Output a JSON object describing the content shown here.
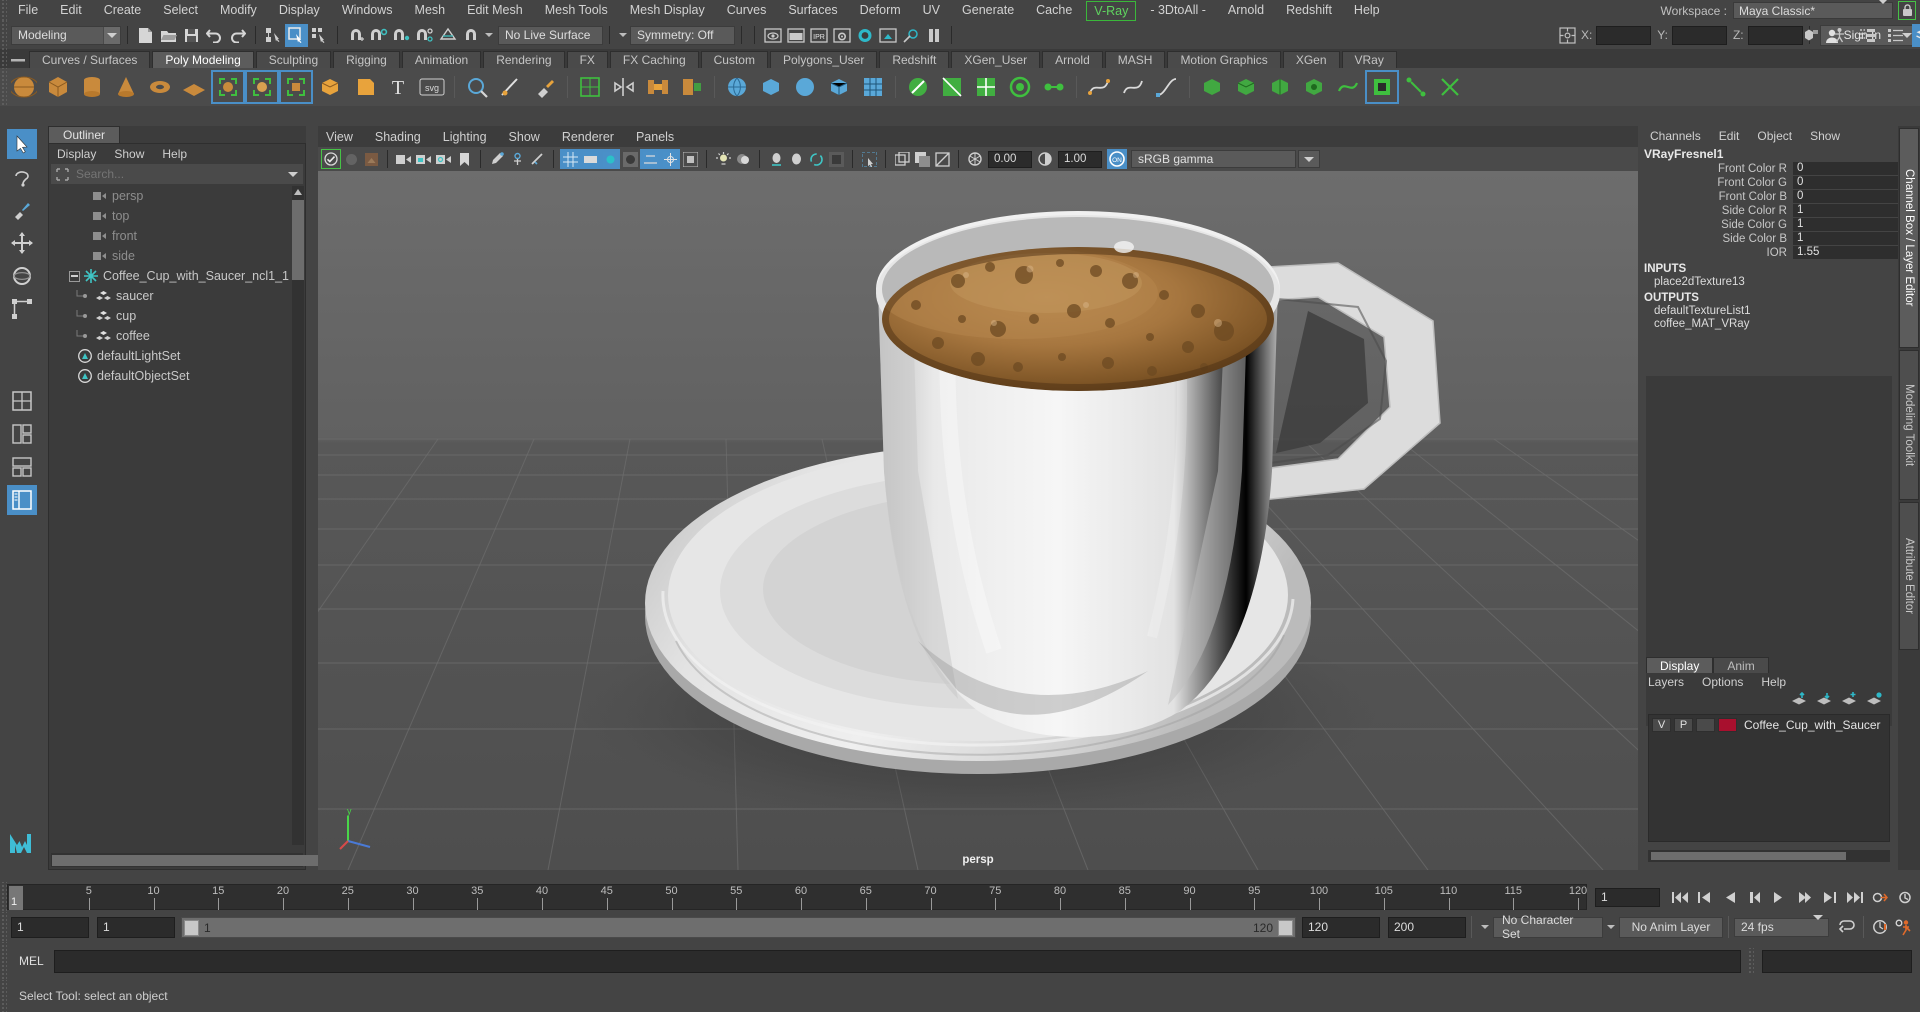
{
  "menubar": {
    "items": [
      "File",
      "Edit",
      "Create",
      "Select",
      "Modify",
      "Display",
      "Windows",
      "Mesh",
      "Edit Mesh",
      "Mesh Tools",
      "Mesh Display",
      "Curves",
      "Surfaces",
      "Deform",
      "UV",
      "Generate",
      "Cache"
    ],
    "highlighted": "V-Ray",
    "items_after": [
      "- 3DtoAll -",
      "Arnold",
      "Redshift",
      "Help"
    ],
    "workspace_label": "Workspace :",
    "workspace_value": "Maya Classic*",
    "lock_icon": "lock-icon",
    "accent_green": "#46c246"
  },
  "statusline": {
    "mode": "Modeling",
    "live_surface": "No Live Surface",
    "symmetry": "Symmetry: Off",
    "coord_x_label": "X:",
    "coord_y_label": "Y:",
    "coord_z_label": "Z:",
    "coord_x": "",
    "coord_y": "",
    "coord_z": "",
    "signin": "Sign In",
    "ipr_label": "IPR"
  },
  "shelf": {
    "tabs": [
      "Curves / Surfaces",
      "Poly Modeling",
      "Sculpting",
      "Rigging",
      "Animation",
      "Rendering",
      "FX",
      "FX Caching",
      "Custom",
      "Polygons_User",
      "Redshift",
      "XGen_User",
      "Arnold",
      "MASH",
      "Motion Graphics",
      "XGen",
      "VRay"
    ],
    "active_tab": "Poly Modeling"
  },
  "outliner": {
    "tab": "Outliner",
    "menu": [
      "Display",
      "Show",
      "Help"
    ],
    "search_placeholder": "Search...",
    "items": [
      {
        "label": "persp",
        "icon": "camera-icon",
        "dim": true,
        "indent": 1
      },
      {
        "label": "top",
        "icon": "camera-icon",
        "dim": true,
        "indent": 1
      },
      {
        "label": "front",
        "icon": "camera-icon",
        "dim": true,
        "indent": 1
      },
      {
        "label": "side",
        "icon": "camera-icon",
        "dim": true,
        "indent": 1
      },
      {
        "label": "Coffee_Cup_with_Saucer_ncl1_1",
        "icon": "nucleus-icon",
        "dim": false,
        "indent": 0,
        "expander": "minus"
      },
      {
        "label": "saucer",
        "icon": "mesh-icon",
        "dim": false,
        "indent": 2
      },
      {
        "label": "cup",
        "icon": "mesh-icon",
        "dim": false,
        "indent": 2
      },
      {
        "label": "coffee",
        "icon": "mesh-icon",
        "dim": false,
        "indent": 2
      },
      {
        "label": "defaultLightSet",
        "icon": "set-icon",
        "dim": false,
        "indent": 1
      },
      {
        "label": "defaultObjectSet",
        "icon": "set-icon",
        "dim": false,
        "indent": 1
      }
    ]
  },
  "viewport": {
    "menu": [
      "View",
      "Shading",
      "Lighting",
      "Show",
      "Renderer",
      "Panels"
    ],
    "exposure": "0.00",
    "gamma": "1.00",
    "color_profile": "sRGB gamma",
    "camera_label": "persp",
    "scene_description": "3D rendered white ceramic coffee cup with crema-topped espresso on a white saucer, on a grey gridded ground plane"
  },
  "channelbox": {
    "menu": [
      "Channels",
      "Edit",
      "Object",
      "Show"
    ],
    "node_name": "VRayFresnel1",
    "attributes": [
      {
        "name": "Front Color R",
        "value": "0"
      },
      {
        "name": "Front Color G",
        "value": "0"
      },
      {
        "name": "Front Color B",
        "value": "0"
      },
      {
        "name": "Side Color R",
        "value": "1"
      },
      {
        "name": "Side Color G",
        "value": "1"
      },
      {
        "name": "Side Color B",
        "value": "1"
      },
      {
        "name": "IOR",
        "value": "1.55"
      }
    ],
    "inputs_header": "INPUTS",
    "inputs": [
      "place2dTexture13"
    ],
    "outputs_header": "OUTPUTS",
    "outputs": [
      "defaultTextureList1",
      "coffee_MAT_VRay"
    ]
  },
  "layer_editor": {
    "tabs": [
      "Display",
      "Anim"
    ],
    "active_tab": "Display",
    "menu": [
      "Layers",
      "Options",
      "Help"
    ],
    "layers": [
      {
        "visibility": "V",
        "playback": "P",
        "type": "",
        "color": "#a8102e",
        "name": "Coffee_Cup_with_Saucer"
      }
    ]
  },
  "vertical_tabs": [
    {
      "label": "Channel Box / Layer Editor",
      "active": true
    },
    {
      "label": "Modeling Toolkit",
      "active": false
    },
    {
      "label": "Attribute Editor",
      "active": false
    }
  ],
  "timeslider": {
    "current_frame": "1",
    "start_label": "1",
    "ticks": [
      5,
      10,
      15,
      20,
      25,
      30,
      35,
      40,
      45,
      50,
      55,
      60,
      65,
      70,
      75,
      80,
      85,
      90,
      95,
      100,
      105,
      110,
      115,
      120
    ],
    "range_end": "120",
    "field_frame": "1"
  },
  "rangeslider": {
    "anim_start": "1",
    "range_start": "1",
    "bar_min": "1",
    "bar_max": "120",
    "range_end": "120",
    "anim_end": "200",
    "character_set": "No Character Set",
    "anim_layer": "No Anim Layer",
    "fps": "24 fps"
  },
  "commandline": {
    "label": "MEL",
    "input_value": "",
    "output_value": ""
  },
  "helpline": {
    "text": "Select Tool: select an object"
  }
}
